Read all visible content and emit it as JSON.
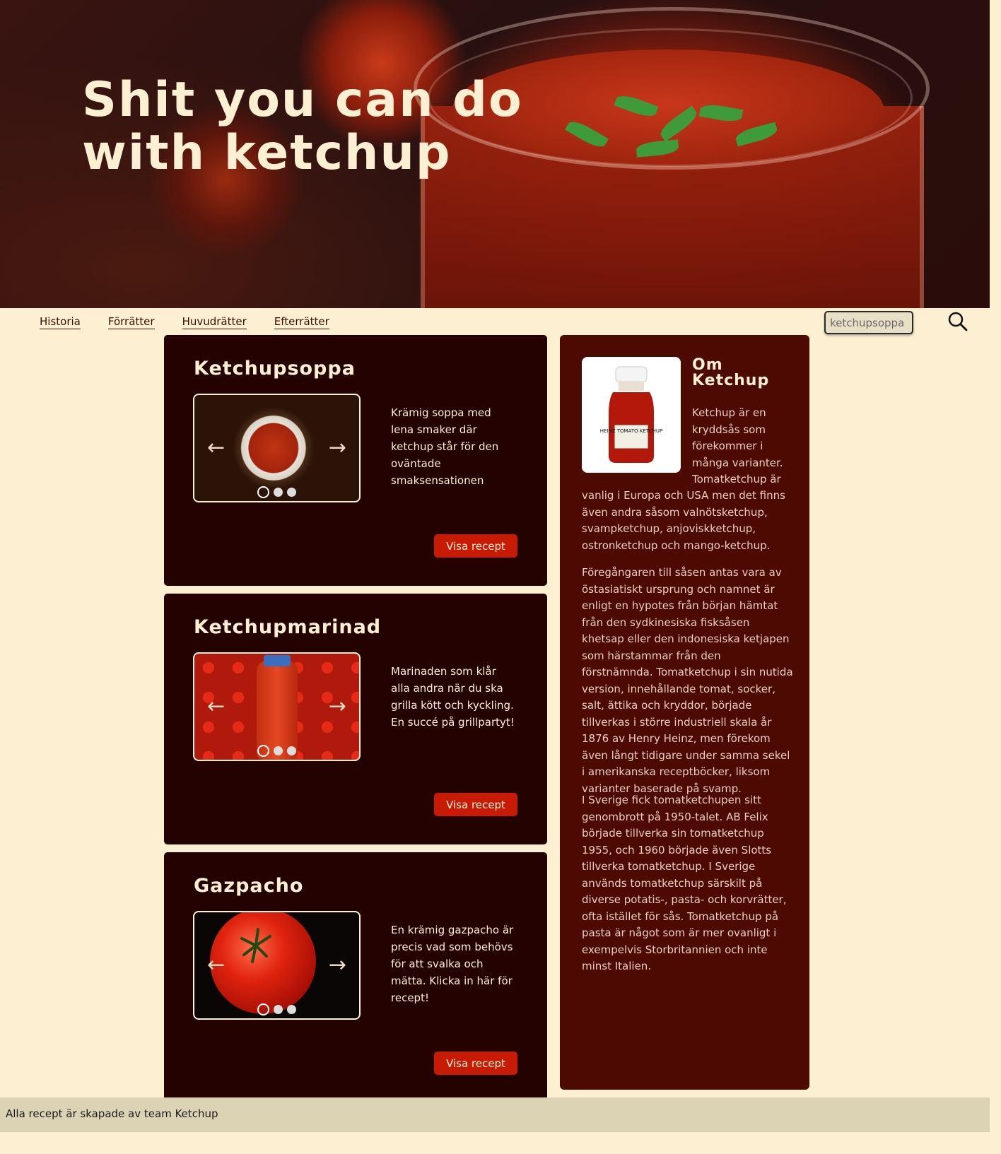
{
  "hero": {
    "title": "Shit you can do with ketchup"
  },
  "nav": {
    "items": [
      "Historia",
      "Förrätter",
      "Huvudrätter",
      "Efterrätter"
    ]
  },
  "search": {
    "value": "ketchupsoppa"
  },
  "recipes": [
    {
      "title": "Ketchupsoppa",
      "description": "Krämig soppa med lena smaker där ketchup står för den oväntade smaksensationen",
      "button": "Visa recept"
    },
    {
      "title": "Ketchupmarinad",
      "description": "Marinaden som klår alla andra när du ska grilla kött och kyckling. En succé på grillpartyt!",
      "button": "Visa recept"
    },
    {
      "title": "Gazpacho",
      "description": "En krämig gazpacho är precis vad som behövs för att svalka och mätta. Klicka in här för recept!",
      "button": "Visa recept"
    }
  ],
  "about": {
    "title": "Om Ketchup",
    "intro_top": "Ketchup är en kryddsås som förekommer i många varianter. Tomatketchup är",
    "intro_bottom": "vanlig i Europa och USA men det finns även andra såsom valnötsketchup, svampketchup, anjoviskketchup, ostronketchup och mango-ketchup.",
    "para2": "Föregångaren till såsen antas vara av östasiatiskt ursprung och namnet är enligt en hypotes från början hämtat från den sydkinesiska fisksåsen khetsap eller den indonesiska ketjapen som härstammar från den förstnämnda. Tomatketchup i sin nutida version, innehållande tomat, socker, salt, ättika och kryddor, började tillverkas i större industriell skala år 1876 av Henry Heinz, men förekom även långt tidigare under samma sekel i amerikanska receptböcker, liksom varianter baserade på svamp.",
    "para3": "I Sverige fick tomatketchupen sitt genombrott på 1950-talet. AB Felix började tillverka sin tomatketchup 1955, och 1960 började även Slotts tillverka tomatketchup. I Sverige används tomatketchup särskilt på diverse potatis-, pasta- och korvrätter, ofta istället för sås. Tomatketchup på pasta är något som är mer ovanligt i exempelvis Storbritannien och inte minst Italien.",
    "bottle_label": "HEINZ TOMATO KETCHUP"
  },
  "footer": {
    "text": "Alla recept är skapade av team Ketchup"
  }
}
